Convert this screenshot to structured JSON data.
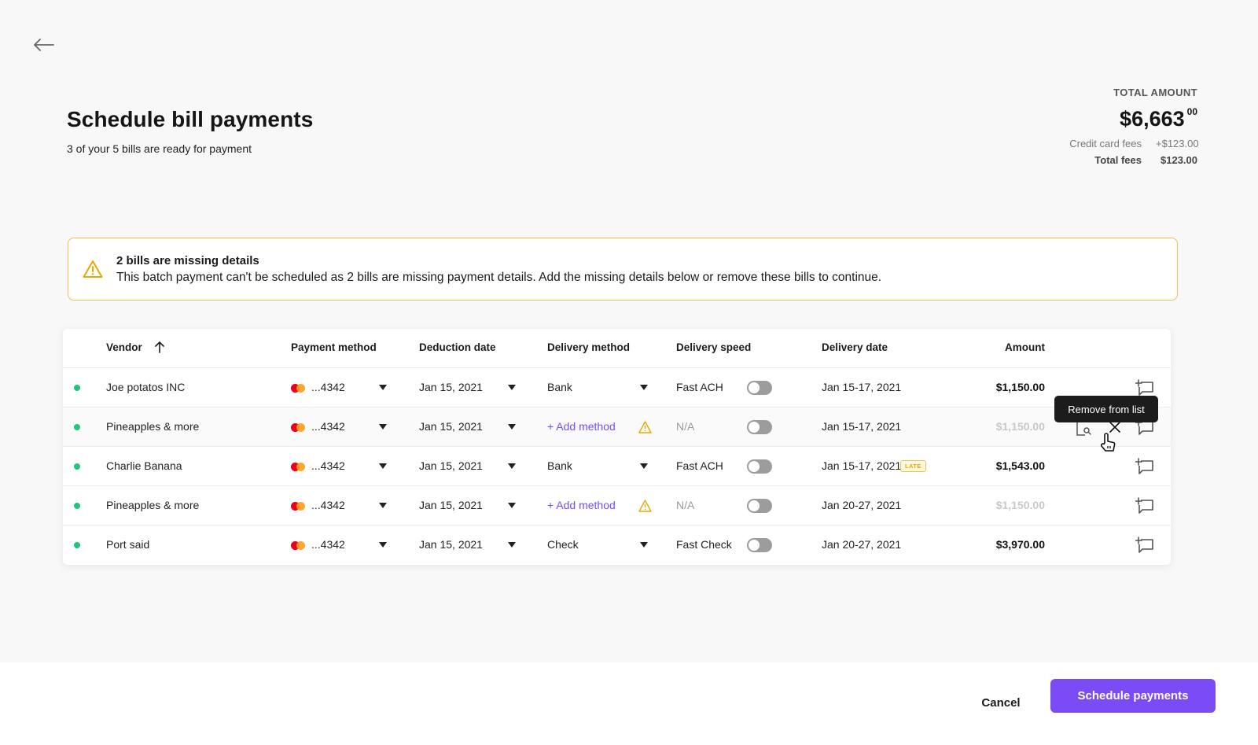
{
  "header": {
    "title": "Schedule bill payments",
    "subtitle": "3 of your 5 bills are ready for payment",
    "back_icon": "arrow-left-icon"
  },
  "summary": {
    "total_label": "TOTAL AMOUNT",
    "total_whole": "$6,663",
    "total_cents": "00",
    "credit_fees_label": "Credit card fees",
    "credit_fees_value": "+$123.00",
    "total_fees_label": "Total fees",
    "total_fees_value": "$123.00"
  },
  "alert": {
    "title": "2 bills are missing details",
    "message": "This batch payment can't be scheduled as 2 bills are missing payment details. Add the missing details below or remove these bills to continue.",
    "color": "#f2c04b"
  },
  "table": {
    "columns": {
      "vendor": "Vendor",
      "payment_method": "Payment  method",
      "deduction_date": "Deduction date",
      "delivery_method": "Delivery method",
      "delivery_speed": "Delivery speed",
      "delivery_date": "Delivery date",
      "amount": "Amount"
    },
    "rows": [
      {
        "vendor": "Joe potatos INC",
        "card": "...4342",
        "deduction": "Jan 15, 2021",
        "delivery_method": "Bank",
        "speed": "Fast ACH",
        "delivery_date": "Jan 15-17, 2021",
        "amount": "$1,150.00"
      },
      {
        "vendor": "Pineapples & more",
        "card": "...4342",
        "deduction": "Jan 15, 2021",
        "delivery_method": "+ Add method",
        "speed": "N/A",
        "delivery_date": "Jan 15-17, 2021",
        "amount": "$1,150.00"
      },
      {
        "vendor": "Charlie Banana",
        "card": "...4342",
        "deduction": "Jan 15, 2021",
        "delivery_method": "Bank",
        "speed": "Fast ACH",
        "delivery_date": "Jan 15-17, 2021",
        "late_badge": "LATE",
        "amount": "$1,543.00"
      },
      {
        "vendor": "Pineapples & more",
        "card": "...4342",
        "deduction": "Jan 15, 2021",
        "delivery_method": "+ Add method",
        "speed": "N/A",
        "delivery_date": "Jan 20-27, 2021",
        "amount": "$1,150.00"
      },
      {
        "vendor": "Port said",
        "card": "...4342",
        "deduction": "Jan 15, 2021",
        "delivery_method": "Check",
        "speed": "Fast Check",
        "delivery_date": "Jan 20-27, 2021",
        "amount": "$3,970.00"
      }
    ],
    "tooltip": "Remove from list"
  },
  "footer": {
    "cancel_label": "Cancel",
    "schedule_label": "Schedule payments",
    "accent_color": "#7b4cf5"
  }
}
